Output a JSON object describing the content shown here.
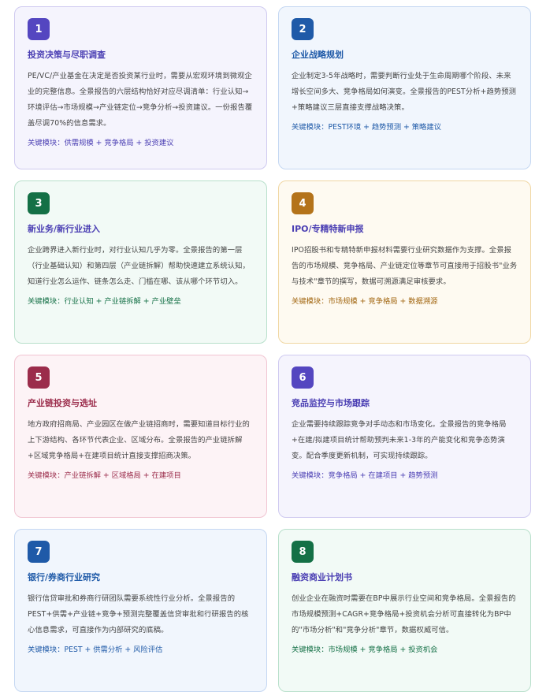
{
  "cards": [
    {
      "number": "1",
      "title": "投资决策与尽职调查",
      "desc": "PE/VC/产业基金在决定是否投资某行业时，需要从宏观环境到微观企业的完整信息。全景报告的六层结构恰好对应尽调清单：行业认知→环境评估→市场规模→产业链定位→竞争分析→投资建议。一份报告覆盖尽调70%的信息需求。",
      "keys": "关键模块：供需规模 + 竞争格局 + 投资建议"
    },
    {
      "number": "2",
      "title": "企业战略规划",
      "desc": "企业制定3-5年战略时，需要判断行业处于生命周期哪个阶段、未来增长空间多大、竞争格局如何演变。全景报告的PEST分析+趋势预测+策略建议三层直接支撑战略决策。",
      "keys": "关键模块：PEST环境 + 趋势预测 + 策略建议"
    },
    {
      "number": "3",
      "title": "新业务/新行业进入",
      "desc": "企业跨界进入新行业时，对行业认知几乎为零。全景报告的第一层（行业基础认知）和第四层（产业链拆解）帮助快速建立系统认知，知道行业怎么运作、链条怎么走、门槛在哪、该从哪个环节切入。",
      "keys": "关键模块：行业认知 + 产业链拆解 + 产业壁垒"
    },
    {
      "number": "4",
      "title": "IPO/专精特新申报",
      "desc": "IPO招股书和专精特新申报材料需要行业研究数据作为支撑。全景报告的市场规模、竞争格局、产业链定位等章节可直接用于招股书\"业务与技术\"章节的撰写，数据可溯源满足审核要求。",
      "keys": "关键模块：市场规模 + 竞争格局 + 数据溯源"
    },
    {
      "number": "5",
      "title": "产业链投资与选址",
      "desc": "地方政府招商局、产业园区在做产业链招商时，需要知道目标行业的上下游结构、各环节代表企业、区域分布。全景报告的产业链拆解+区域竞争格局+在建项目统计直接支撑招商决策。",
      "keys": "关键模块：产业链拆解 + 区域格局 + 在建项目"
    },
    {
      "number": "6",
      "title": "竞品监控与市场跟踪",
      "desc": "企业需要持续跟踪竞争对手动态和市场变化。全景报告的竞争格局+在建/拟建项目统计帮助预判未来1-3年的产能变化和竞争态势演变。配合季度更新机制，可实现持续跟踪。",
      "keys": "关键模块：竞争格局 + 在建项目 + 趋势预测"
    },
    {
      "number": "7",
      "title": "银行/券商行业研究",
      "desc": "银行信贷审批和券商行研团队需要系统性行业分析。全景报告的PEST+供需+产业链+竞争+预测完整覆盖信贷审批和行研报告的核心信息需求，可直接作为内部研究的底稿。",
      "keys": "关键模块：PEST + 供需分析 + 风险评估"
    },
    {
      "number": "8",
      "title": "融资商业计划书",
      "desc": "创业企业在融资时需要在BP中展示行业空间和竞争格局。全景报告的市场规模预测+CAGR+竞争格局+投资机会分析可直接转化为BP中的\"市场分析\"和\"竞争分析\"章节，数据权威可信。",
      "keys": "关键模块：市场规模 + 竞争格局 + 投资机会"
    }
  ]
}
